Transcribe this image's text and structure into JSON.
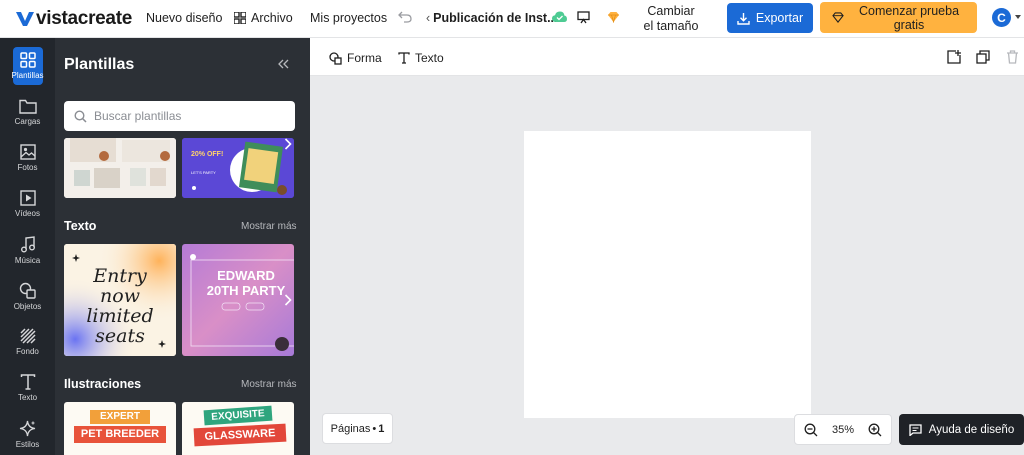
{
  "app": {
    "brand": "vistacreate"
  },
  "nav": {
    "new_design": "Nuevo diseño",
    "file": "Archivo",
    "my_projects": "Mis proyectos",
    "doc_title": "Publicación de Inst...",
    "resize": "Cambiar el tamaño"
  },
  "actions": {
    "export": "Exportar",
    "trial": "Comenzar prueba gratis",
    "avatar_letter": "C"
  },
  "rail": {
    "items": [
      {
        "label": "Plantillas",
        "icon": "templates-icon",
        "active": true
      },
      {
        "label": "Cargas",
        "icon": "folder-icon"
      },
      {
        "label": "Fotos",
        "icon": "image-icon"
      },
      {
        "label": "Vídeos",
        "icon": "video-icon"
      },
      {
        "label": "Música",
        "icon": "music-icon"
      },
      {
        "label": "Objetos",
        "icon": "shapes-icon"
      },
      {
        "label": "Fondo",
        "icon": "background-icon"
      },
      {
        "label": "Texto",
        "icon": "text-icon"
      },
      {
        "label": "Estilos",
        "icon": "sparkle-icon"
      }
    ]
  },
  "panel": {
    "title": "Plantillas",
    "search_placeholder": "Buscar plantillas",
    "sections": [
      {
        "title": "Texto",
        "more": "Mostrar más",
        "thumbs": [
          {
            "lines": [
              "Entry",
              "now",
              "limited",
              "seats"
            ]
          },
          {
            "lines": [
              "EDWARD",
              "20TH PARTY"
            ]
          }
        ]
      },
      {
        "title": "Ilustraciones",
        "more": "Mostrar más",
        "thumbs": [
          {
            "lines": [
              "EXPERT",
              "PET BREEDER"
            ]
          },
          {
            "lines": [
              "EXQUISITE",
              "GLASSWARE"
            ]
          }
        ]
      }
    ],
    "top_thumbs": [
      {
        "lines": [
          "20% OFF!",
          "LET'S PARTY"
        ]
      }
    ]
  },
  "toolbar": {
    "shape": "Forma",
    "text": "Texto"
  },
  "footer": {
    "pages_label": "Páginas",
    "pages_count": "1",
    "zoom": "35%",
    "help": "Ayuda de diseño"
  },
  "colors": {
    "accent": "#1b6ad6",
    "trial": "#ffb23f",
    "rail_bg": "#22262c",
    "panel_bg": "#2c3036"
  }
}
